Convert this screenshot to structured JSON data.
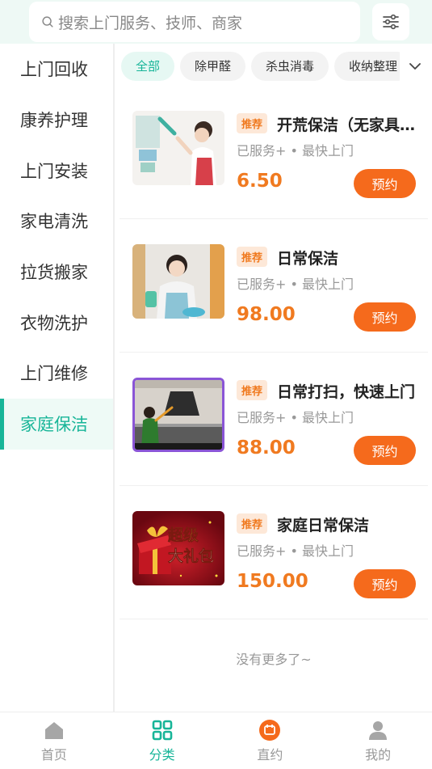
{
  "search": {
    "placeholder": "搜索上门服务、技师、商家"
  },
  "sidebar": {
    "items": [
      {
        "label": "上门回收"
      },
      {
        "label": "康养护理"
      },
      {
        "label": "上门安装"
      },
      {
        "label": "家电清洗"
      },
      {
        "label": "拉货搬家"
      },
      {
        "label": "衣物洗护"
      },
      {
        "label": "上门维修"
      },
      {
        "label": "家庭保洁",
        "active": true
      }
    ]
  },
  "tags": [
    {
      "label": "全部",
      "active": true
    },
    {
      "label": "除甲醛"
    },
    {
      "label": "杀虫消毒"
    },
    {
      "label": "收纳整理"
    }
  ],
  "services": [
    {
      "badge": "推荐",
      "title": "开荒保洁（无家具保洁）",
      "meta": "已服务+ • 最快上门",
      "price": "6.50",
      "book": "预约",
      "image": "cleaning-woman-duster"
    },
    {
      "badge": "推荐",
      "title": "日常保洁",
      "meta": "已服务+ • 最快上门",
      "price": "98.00",
      "book": "预约",
      "image": "smiling-cleaner"
    },
    {
      "badge": "推荐",
      "title": "日常打扫，快速上门",
      "meta": "已服务+ • 最快上门",
      "price": "88.00",
      "book": "预约",
      "image": "kitchen-cleaning"
    },
    {
      "badge": "推荐",
      "title": "家庭日常保洁",
      "meta": "已服务+ • 最快上门",
      "price": "150.00",
      "book": "预约",
      "image": "gift-box-promo",
      "image_text": "超级大礼包"
    }
  ],
  "footer": {
    "no_more": "没有更多了~"
  },
  "nav": [
    {
      "label": "首页",
      "icon": "home-icon"
    },
    {
      "label": "分类",
      "icon": "grid-icon",
      "active": true
    },
    {
      "label": "直约",
      "icon": "booking-icon"
    },
    {
      "label": "我的",
      "icon": "user-icon"
    }
  ],
  "colors": {
    "accent": "#17b598",
    "orange": "#f56a1c",
    "price": "#f07a20"
  }
}
